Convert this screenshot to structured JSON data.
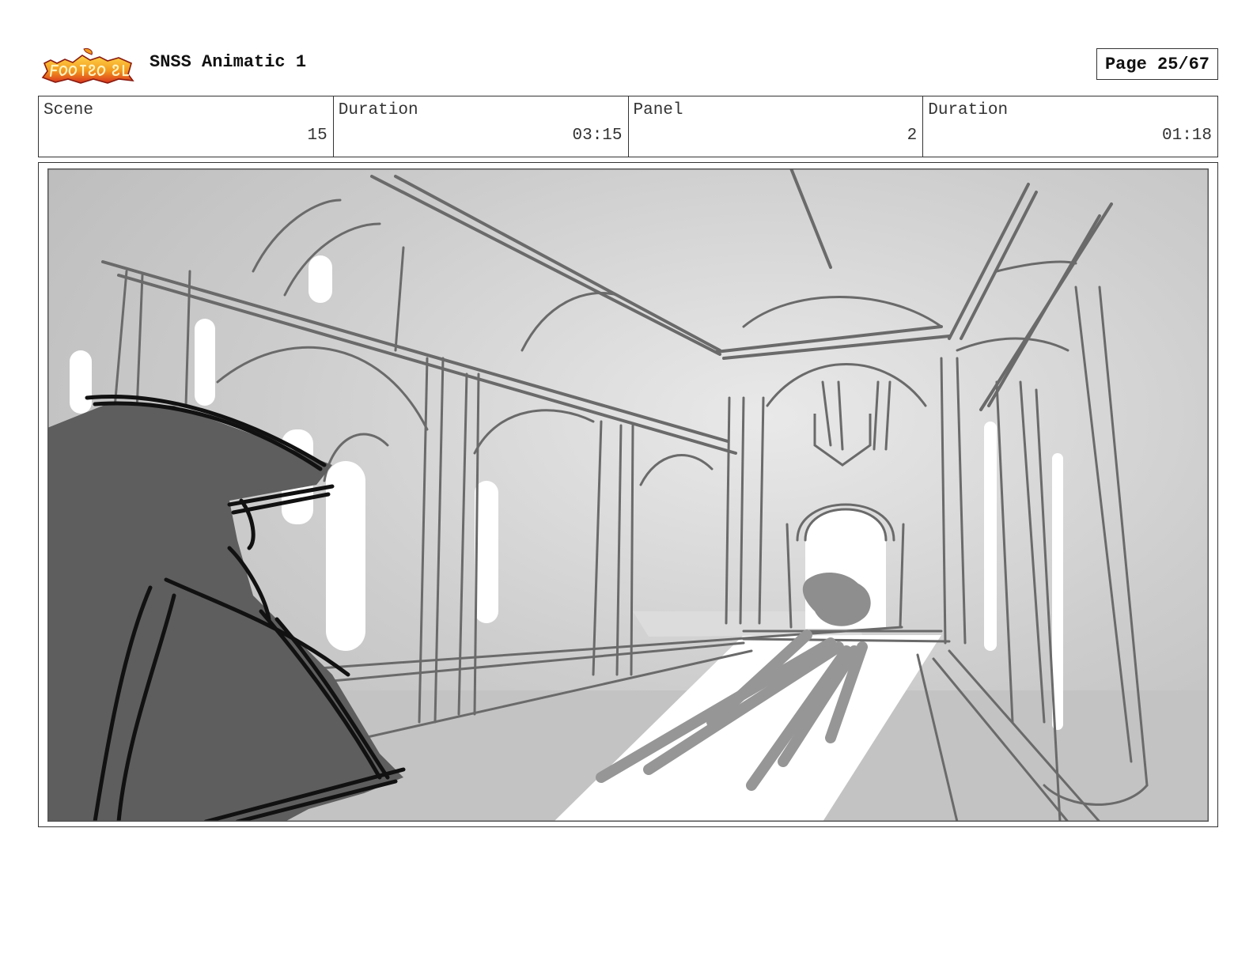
{
  "header": {
    "logo_text": "Sir Foot-So-Sneer",
    "title": "SNSS Animatic 1",
    "page_label": "Page 25/67"
  },
  "info": {
    "scene_label": "Scene",
    "scene_value": "15",
    "duration_label": "Duration",
    "duration_value": "03:15",
    "panel_label": "Panel",
    "panel_value": "2",
    "panel_duration_label": "Duration",
    "panel_duration_value": "01:18"
  },
  "colors": {
    "logo_red": "#d8321e",
    "logo_orange": "#f39a1d",
    "sketch_line": "#6a6a6a",
    "character_fill": "#5e5e5e",
    "ink": "#111111"
  }
}
